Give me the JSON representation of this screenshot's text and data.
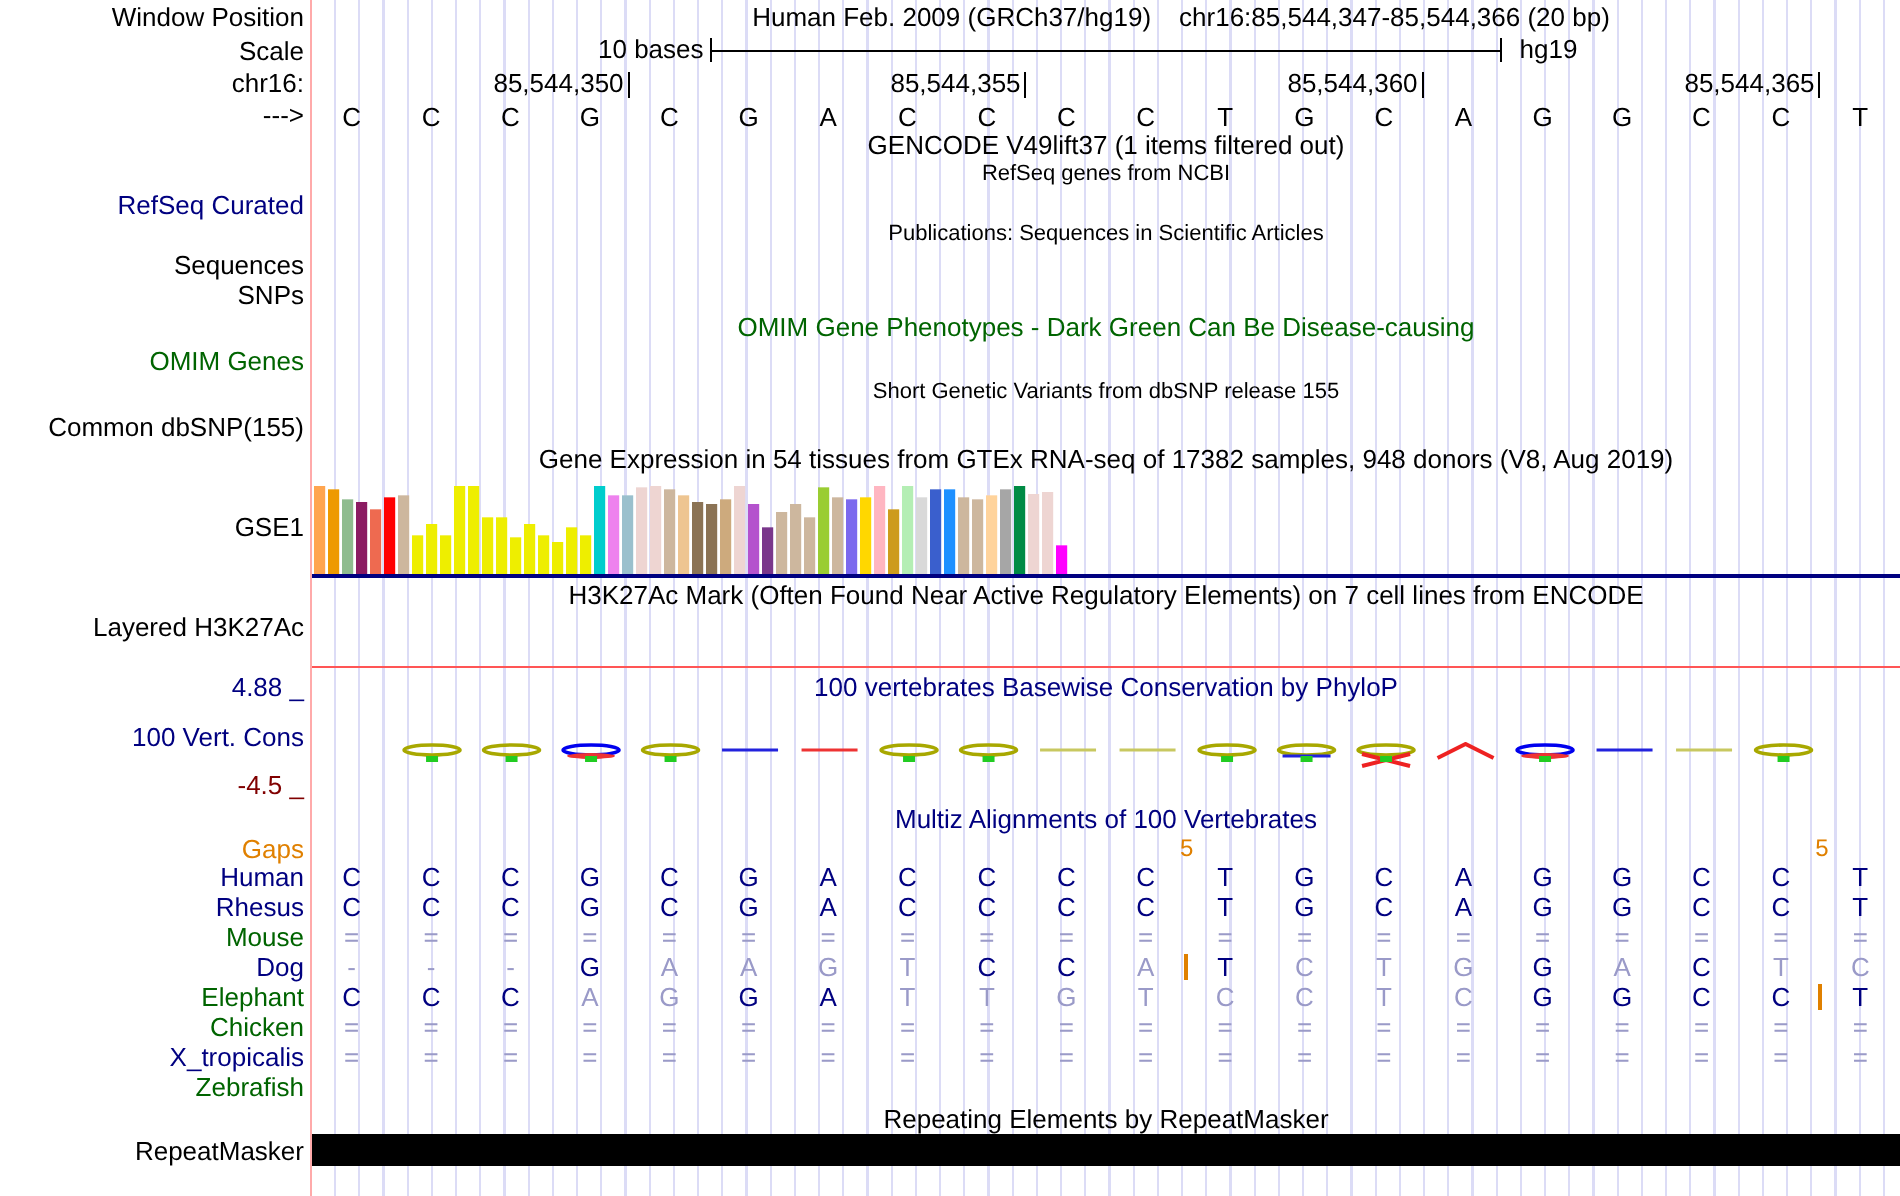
{
  "header": {
    "window_position_label": "Window Position",
    "assembly": "Human Feb. 2009 (GRCh37/hg19)",
    "region": "chr16:85,544,347-85,544,366 (20 bp)",
    "scale_label": "Scale",
    "scale_text": "10 bases",
    "scale_db": "hg19",
    "chrom_label": "chr16:",
    "positions": [
      "85,544,350",
      "85,544,355",
      "85,544,360",
      "85,544,365"
    ],
    "strand": "--->",
    "bases": [
      "C",
      "C",
      "C",
      "G",
      "C",
      "G",
      "A",
      "C",
      "C",
      "C",
      "C",
      "T",
      "G",
      "C",
      "A",
      "G",
      "G",
      "C",
      "C",
      "T"
    ]
  },
  "gencode": {
    "title": "GENCODE V49lift37 (1 items filtered out)"
  },
  "refseq": {
    "title": "RefSeq genes from NCBI",
    "label": "RefSeq Curated"
  },
  "publications": {
    "title": "Publications: Sequences in Scientific Articles",
    "labels": [
      "Sequences",
      "SNPs"
    ]
  },
  "omim": {
    "title": "OMIM Gene Phenotypes - Dark Green Can Be Disease-causing",
    "label": "OMIM Genes"
  },
  "dbsnp": {
    "title": "Short Genetic Variants from dbSNP release 155",
    "label": "Common dbSNP(155)"
  },
  "gtex": {
    "title": "Gene Expression in 54 tissues from GTEx RNA-seq of 17382 samples, 948 donors (V8, Aug 2019)",
    "label": "GSE1"
  },
  "h3k27ac": {
    "title": "H3K27Ac Mark (Often Found Near Active Regulatory Elements) on 7 cell lines from ENCODE",
    "label": "Layered H3K27Ac"
  },
  "phylop": {
    "title": "100 vertebrates Basewise Conservation by PhyloP",
    "label": "100 Vert. Cons",
    "max_label": "4.88 _",
    "min_label": "-4.5 _"
  },
  "multiz": {
    "title": "Multiz Alignments of 100 Vertebrates",
    "gaps_label": "Gaps",
    "gap_counts": [
      "5",
      "5"
    ],
    "species": [
      {
        "name": "Human",
        "color": "#000080",
        "bases": [
          {
            "b": "C",
            "dim": false,
            "ins": false
          },
          {
            "b": "C",
            "dim": false,
            "ins": false
          },
          {
            "b": "C",
            "dim": false,
            "ins": false
          },
          {
            "b": "G",
            "dim": false,
            "ins": false
          },
          {
            "b": "C",
            "dim": false,
            "ins": false
          },
          {
            "b": "G",
            "dim": false,
            "ins": false
          },
          {
            "b": "A",
            "dim": false,
            "ins": false
          },
          {
            "b": "C",
            "dim": false,
            "ins": false
          },
          {
            "b": "C",
            "dim": false,
            "ins": false
          },
          {
            "b": "C",
            "dim": false,
            "ins": false
          },
          {
            "b": "C",
            "dim": false,
            "ins": false
          },
          {
            "b": "T",
            "dim": false,
            "ins": false
          },
          {
            "b": "G",
            "dim": false,
            "ins": false
          },
          {
            "b": "C",
            "dim": false,
            "ins": false
          },
          {
            "b": "A",
            "dim": false,
            "ins": false
          },
          {
            "b": "G",
            "dim": false,
            "ins": false
          },
          {
            "b": "G",
            "dim": false,
            "ins": false
          },
          {
            "b": "C",
            "dim": false,
            "ins": false
          },
          {
            "b": "C",
            "dim": false,
            "ins": false
          },
          {
            "b": "T",
            "dim": false,
            "ins": false
          }
        ]
      },
      {
        "name": "Rhesus",
        "color": "#000080",
        "bases": [
          {
            "b": "C",
            "dim": false,
            "ins": false
          },
          {
            "b": "C",
            "dim": false,
            "ins": false
          },
          {
            "b": "C",
            "dim": false,
            "ins": false
          },
          {
            "b": "G",
            "dim": false,
            "ins": false
          },
          {
            "b": "C",
            "dim": false,
            "ins": false
          },
          {
            "b": "G",
            "dim": false,
            "ins": false
          },
          {
            "b": "A",
            "dim": false,
            "ins": false
          },
          {
            "b": "C",
            "dim": false,
            "ins": false
          },
          {
            "b": "C",
            "dim": false,
            "ins": false
          },
          {
            "b": "C",
            "dim": false,
            "ins": false
          },
          {
            "b": "C",
            "dim": false,
            "ins": false
          },
          {
            "b": "T",
            "dim": false,
            "ins": false
          },
          {
            "b": "G",
            "dim": false,
            "ins": false
          },
          {
            "b": "C",
            "dim": false,
            "ins": false
          },
          {
            "b": "A",
            "dim": false,
            "ins": false
          },
          {
            "b": "G",
            "dim": false,
            "ins": false
          },
          {
            "b": "G",
            "dim": false,
            "ins": false
          },
          {
            "b": "C",
            "dim": false,
            "ins": false
          },
          {
            "b": "C",
            "dim": false,
            "ins": false
          },
          {
            "b": "T",
            "dim": false,
            "ins": false
          }
        ]
      },
      {
        "name": "Mouse",
        "color": "#006400",
        "bases": [
          {
            "b": "=",
            "dim": true,
            "ins": false
          },
          {
            "b": "=",
            "dim": true,
            "ins": false
          },
          {
            "b": "=",
            "dim": true,
            "ins": false
          },
          {
            "b": "=",
            "dim": true,
            "ins": false
          },
          {
            "b": "=",
            "dim": true,
            "ins": false
          },
          {
            "b": "=",
            "dim": true,
            "ins": false
          },
          {
            "b": "=",
            "dim": true,
            "ins": false
          },
          {
            "b": "=",
            "dim": true,
            "ins": false
          },
          {
            "b": "=",
            "dim": true,
            "ins": false
          },
          {
            "b": "=",
            "dim": true,
            "ins": false
          },
          {
            "b": "=",
            "dim": true,
            "ins": false
          },
          {
            "b": "=",
            "dim": true,
            "ins": false
          },
          {
            "b": "=",
            "dim": true,
            "ins": false
          },
          {
            "b": "=",
            "dim": true,
            "ins": false
          },
          {
            "b": "=",
            "dim": true,
            "ins": false
          },
          {
            "b": "=",
            "dim": true,
            "ins": false
          },
          {
            "b": "=",
            "dim": true,
            "ins": false
          },
          {
            "b": "=",
            "dim": true,
            "ins": false
          },
          {
            "b": "=",
            "dim": true,
            "ins": false
          },
          {
            "b": "=",
            "dim": true,
            "ins": false
          }
        ]
      },
      {
        "name": "Dog",
        "color": "#000080",
        "bases": [
          {
            "b": "-",
            "dim": true,
            "ins": false
          },
          {
            "b": "-",
            "dim": true,
            "ins": false
          },
          {
            "b": "-",
            "dim": true,
            "ins": false
          },
          {
            "b": "G",
            "dim": false,
            "ins": false
          },
          {
            "b": "A",
            "dim": true,
            "ins": false
          },
          {
            "b": "A",
            "dim": true,
            "ins": false
          },
          {
            "b": "G",
            "dim": true,
            "ins": false
          },
          {
            "b": "T",
            "dim": true,
            "ins": false
          },
          {
            "b": "C",
            "dim": false,
            "ins": false
          },
          {
            "b": "C",
            "dim": false,
            "ins": false
          },
          {
            "b": "A",
            "dim": true,
            "ins": true
          },
          {
            "b": "T",
            "dim": false,
            "ins": false
          },
          {
            "b": "C",
            "dim": true,
            "ins": false
          },
          {
            "b": "T",
            "dim": true,
            "ins": false
          },
          {
            "b": "G",
            "dim": true,
            "ins": false
          },
          {
            "b": "G",
            "dim": false,
            "ins": false
          },
          {
            "b": "A",
            "dim": true,
            "ins": false
          },
          {
            "b": "C",
            "dim": false,
            "ins": false
          },
          {
            "b": "T",
            "dim": true,
            "ins": false
          },
          {
            "b": "C",
            "dim": true,
            "ins": false
          }
        ]
      },
      {
        "name": "Elephant",
        "color": "#006400",
        "bases": [
          {
            "b": "C",
            "dim": false,
            "ins": false
          },
          {
            "b": "C",
            "dim": false,
            "ins": false
          },
          {
            "b": "C",
            "dim": false,
            "ins": false
          },
          {
            "b": "A",
            "dim": true,
            "ins": false
          },
          {
            "b": "G",
            "dim": true,
            "ins": false
          },
          {
            "b": "G",
            "dim": false,
            "ins": false
          },
          {
            "b": "A",
            "dim": false,
            "ins": false
          },
          {
            "b": "T",
            "dim": true,
            "ins": false
          },
          {
            "b": "T",
            "dim": true,
            "ins": false
          },
          {
            "b": "G",
            "dim": true,
            "ins": false
          },
          {
            "b": "T",
            "dim": true,
            "ins": false
          },
          {
            "b": "C",
            "dim": true,
            "ins": false
          },
          {
            "b": "C",
            "dim": true,
            "ins": false
          },
          {
            "b": "T",
            "dim": true,
            "ins": false
          },
          {
            "b": "C",
            "dim": true,
            "ins": false
          },
          {
            "b": "G",
            "dim": false,
            "ins": false
          },
          {
            "b": "G",
            "dim": false,
            "ins": false
          },
          {
            "b": "C",
            "dim": false,
            "ins": false
          },
          {
            "b": "C",
            "dim": false,
            "ins": true
          },
          {
            "b": "T",
            "dim": false,
            "ins": false
          }
        ]
      },
      {
        "name": "Chicken",
        "color": "#006400",
        "bases": [
          {
            "b": "=",
            "dim": true,
            "ins": false
          },
          {
            "b": "=",
            "dim": true,
            "ins": false
          },
          {
            "b": "=",
            "dim": true,
            "ins": false
          },
          {
            "b": "=",
            "dim": true,
            "ins": false
          },
          {
            "b": "=",
            "dim": true,
            "ins": false
          },
          {
            "b": "=",
            "dim": true,
            "ins": false
          },
          {
            "b": "=",
            "dim": true,
            "ins": false
          },
          {
            "b": "=",
            "dim": true,
            "ins": false
          },
          {
            "b": "=",
            "dim": true,
            "ins": false
          },
          {
            "b": "=",
            "dim": true,
            "ins": false
          },
          {
            "b": "=",
            "dim": true,
            "ins": false
          },
          {
            "b": "=",
            "dim": true,
            "ins": false
          },
          {
            "b": "=",
            "dim": true,
            "ins": false
          },
          {
            "b": "=",
            "dim": true,
            "ins": false
          },
          {
            "b": "=",
            "dim": true,
            "ins": false
          },
          {
            "b": "=",
            "dim": true,
            "ins": false
          },
          {
            "b": "=",
            "dim": true,
            "ins": false
          },
          {
            "b": "=",
            "dim": true,
            "ins": false
          },
          {
            "b": "=",
            "dim": true,
            "ins": false
          },
          {
            "b": "=",
            "dim": true,
            "ins": false
          }
        ]
      },
      {
        "name": "X_tropicalis",
        "color": "#000080",
        "bases": [
          {
            "b": "=",
            "dim": true,
            "ins": false
          },
          {
            "b": "=",
            "dim": true,
            "ins": false
          },
          {
            "b": "=",
            "dim": true,
            "ins": false
          },
          {
            "b": "=",
            "dim": true,
            "ins": false
          },
          {
            "b": "=",
            "dim": true,
            "ins": false
          },
          {
            "b": "=",
            "dim": true,
            "ins": false
          },
          {
            "b": "=",
            "dim": true,
            "ins": false
          },
          {
            "b": "=",
            "dim": true,
            "ins": false
          },
          {
            "b": "=",
            "dim": true,
            "ins": false
          },
          {
            "b": "=",
            "dim": true,
            "ins": false
          },
          {
            "b": "=",
            "dim": true,
            "ins": false
          },
          {
            "b": "=",
            "dim": true,
            "ins": false
          },
          {
            "b": "=",
            "dim": true,
            "ins": false
          },
          {
            "b": "=",
            "dim": true,
            "ins": false
          },
          {
            "b": "=",
            "dim": true,
            "ins": false
          },
          {
            "b": "=",
            "dim": true,
            "ins": false
          },
          {
            "b": "=",
            "dim": true,
            "ins": false
          },
          {
            "b": "=",
            "dim": true,
            "ins": false
          },
          {
            "b": "=",
            "dim": true,
            "ins": false
          },
          {
            "b": "=",
            "dim": true,
            "ins": false
          }
        ]
      },
      {
        "name": "Zebrafish",
        "color": "#006400"
      }
    ]
  },
  "repeatmasker": {
    "title": "Repeating Elements by RepeatMasker",
    "label": "RepeatMasker"
  }
}
